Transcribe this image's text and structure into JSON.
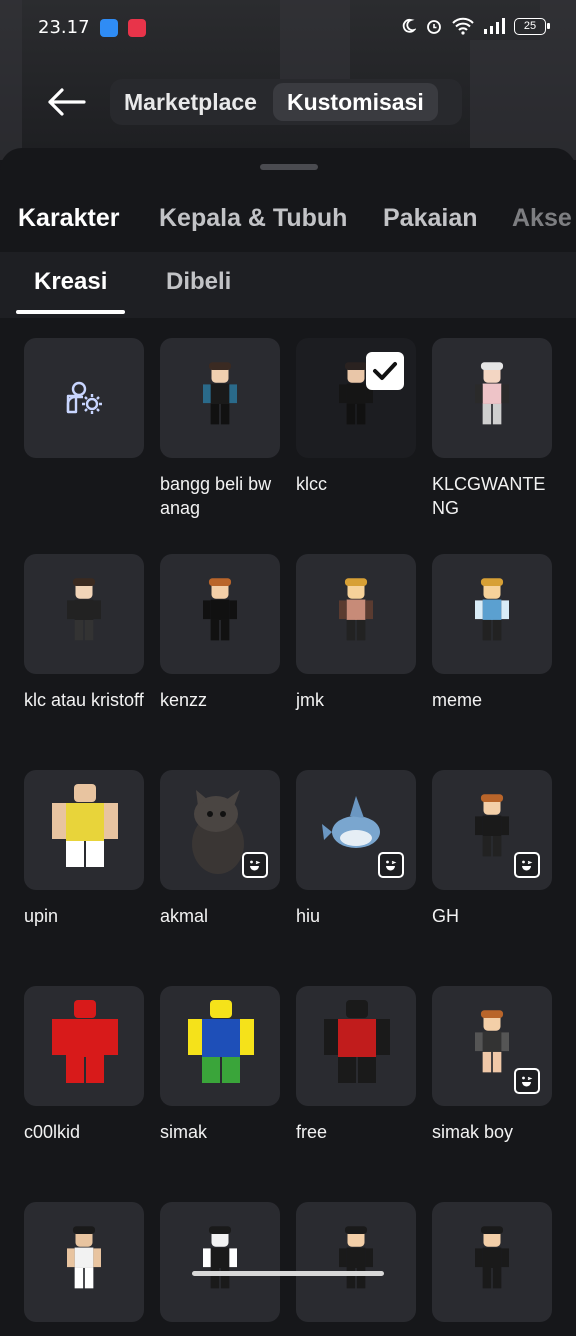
{
  "status": {
    "time": "23.17",
    "battery": "25"
  },
  "header": {
    "tabs": [
      "Marketplace",
      "Kustomisasi"
    ],
    "active_tab": 1
  },
  "categories": [
    "Karakter",
    "Kepala & Tubuh",
    "Pakaian",
    "Akse"
  ],
  "subtabs": [
    "Kreasi",
    "Dibeli"
  ],
  "items": [
    {
      "label": "",
      "type": "create"
    },
    {
      "label": "bangg beli bwanag"
    },
    {
      "label": "klcc",
      "selected": true
    },
    {
      "label": "KLCGWANTENG"
    },
    {
      "label": "klc atau kristoff"
    },
    {
      "label": "kenzz"
    },
    {
      "label": "jmk"
    },
    {
      "label": "meme"
    },
    {
      "label": "upin"
    },
    {
      "label": "akmal",
      "emote": true
    },
    {
      "label": "hiu",
      "emote": true
    },
    {
      "label": "GH",
      "emote": true
    },
    {
      "label": "c00lkid"
    },
    {
      "label": "simak"
    },
    {
      "label": "free"
    },
    {
      "label": "simak boy",
      "emote": true
    },
    {
      "label": ""
    },
    {
      "label": ""
    },
    {
      "label": ""
    },
    {
      "label": ""
    }
  ],
  "colors": {
    "background": "#16171a",
    "tile": "#2a2b30",
    "accent_white": "#ffffff"
  }
}
